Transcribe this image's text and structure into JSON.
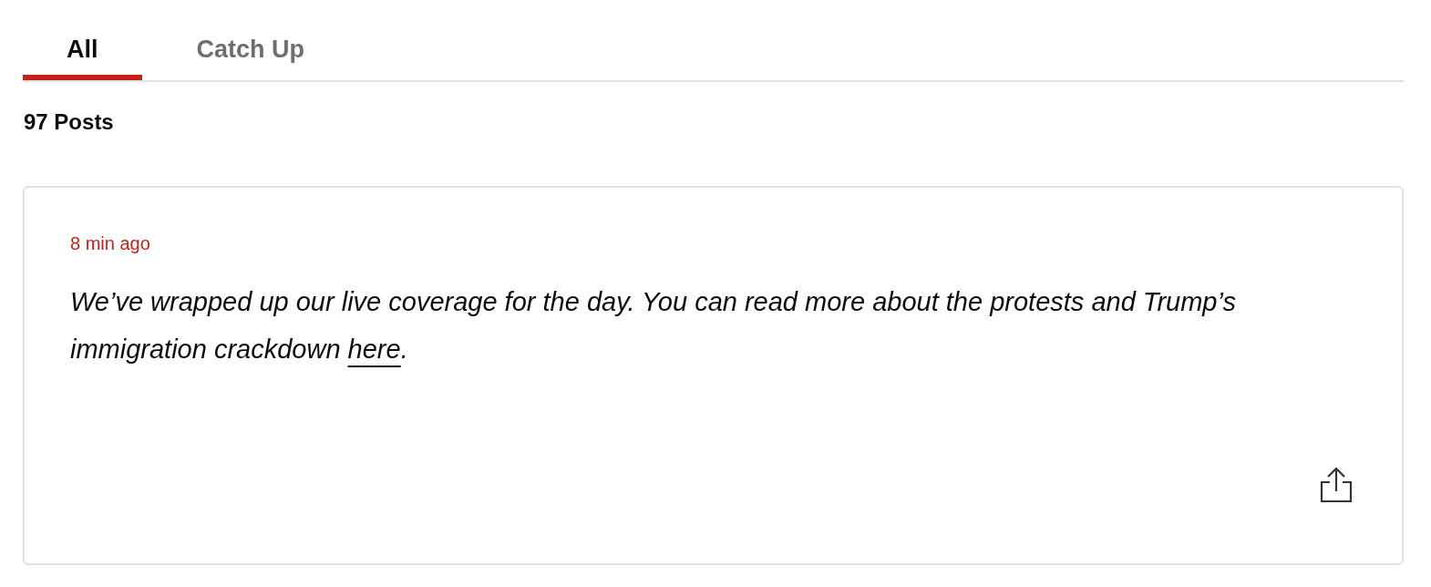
{
  "tabs": [
    {
      "label": "All",
      "selected": true
    },
    {
      "label": "Catch Up",
      "selected": false
    }
  ],
  "post_count": "97 Posts",
  "posts": [
    {
      "timestamp": "8 min ago",
      "text_before": "We’ve wrapped up our live coverage for the day. You can read more about the protests and Trump’s immigration crackdown ",
      "link": "here",
      "text_after": "."
    }
  ]
}
